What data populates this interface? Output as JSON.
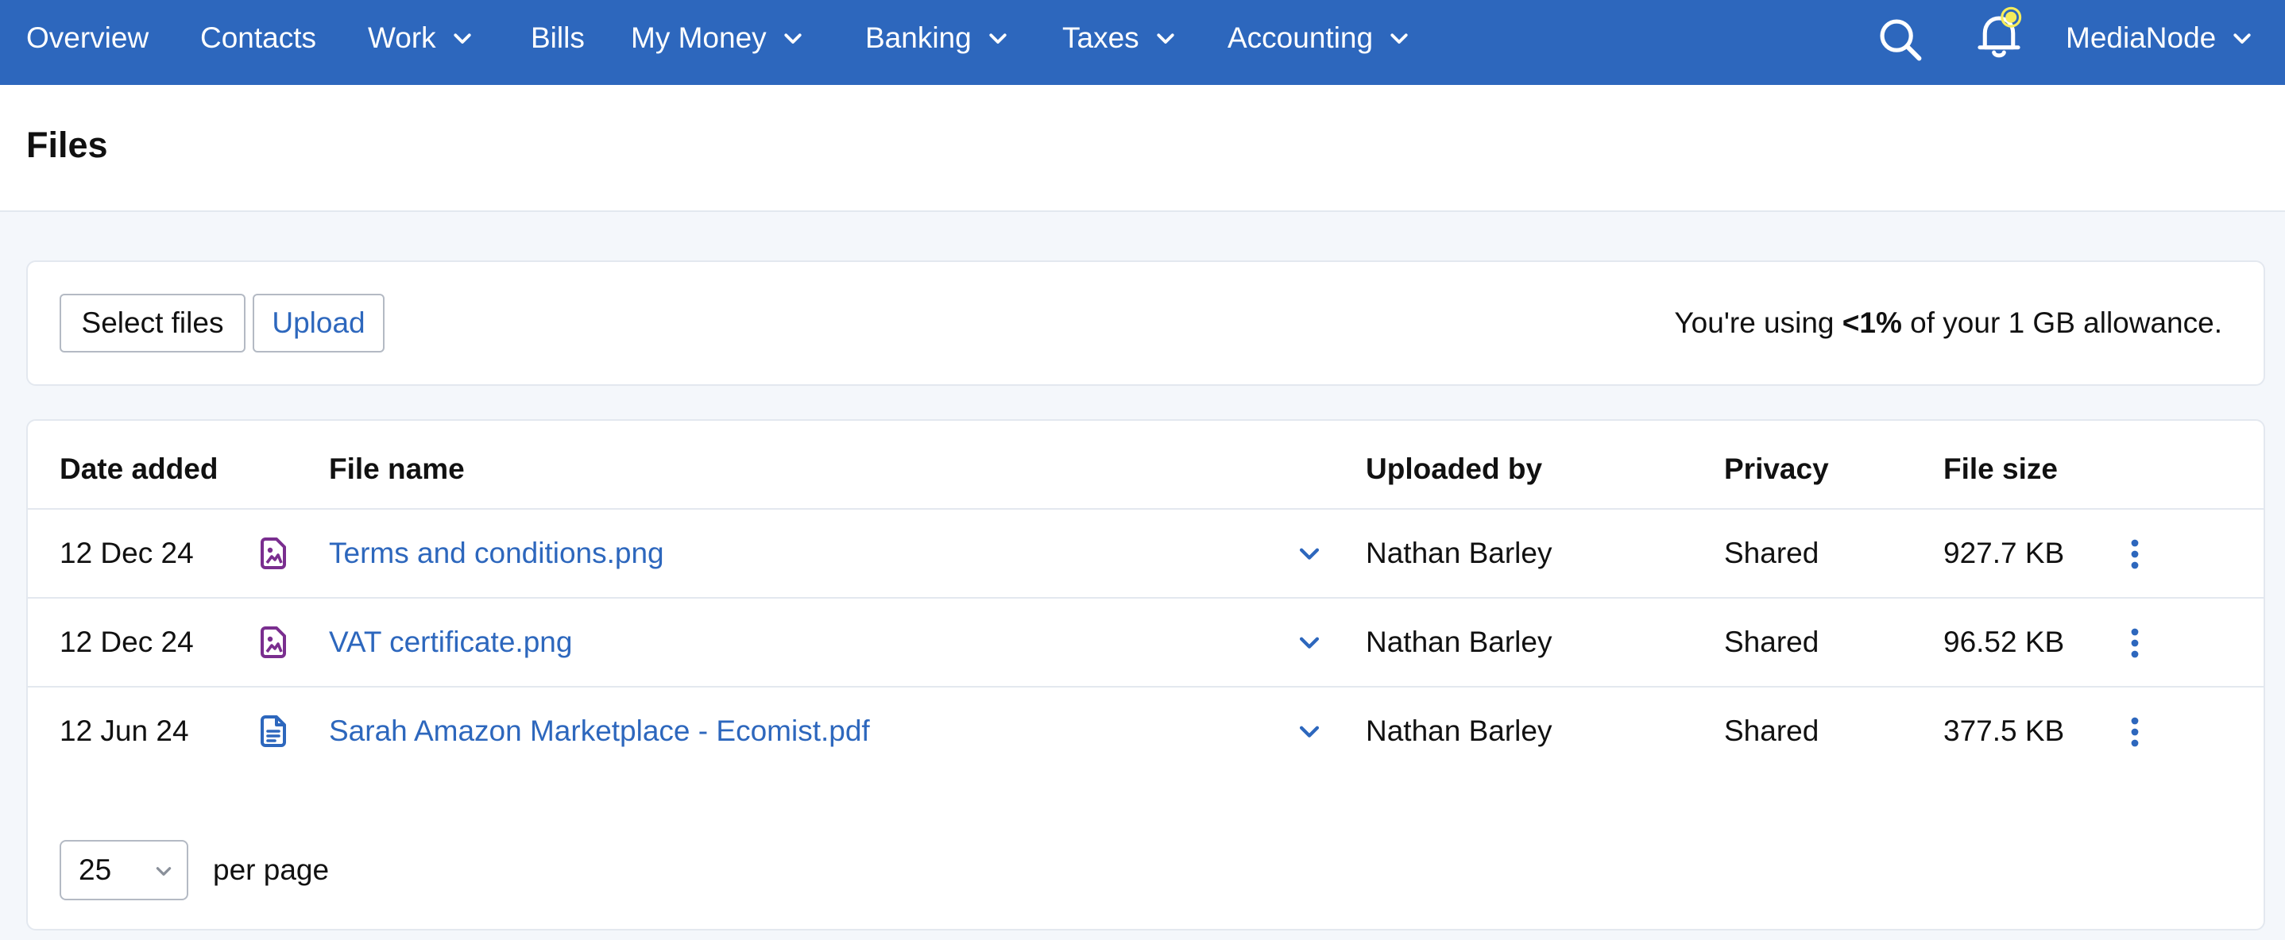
{
  "nav": {
    "items": [
      {
        "label": "Overview",
        "dropdown": false
      },
      {
        "label": "Contacts",
        "dropdown": false
      },
      {
        "label": "Work",
        "dropdown": true
      },
      {
        "label": "Bills",
        "dropdown": false
      },
      {
        "label": "My Money",
        "dropdown": true
      },
      {
        "label": "Banking",
        "dropdown": true
      },
      {
        "label": "Taxes",
        "dropdown": true
      },
      {
        "label": "Accounting",
        "dropdown": true
      }
    ],
    "account_label": "MediaNode",
    "icons": {
      "search": "search-icon",
      "notifications": "bell-icon",
      "notification_dot_color": "#f5ec5b"
    },
    "background_color": "#2d67bd"
  },
  "page": {
    "title": "Files"
  },
  "upload": {
    "select_files_label": "Select files",
    "upload_label": "Upload",
    "allowance_prefix": "You're using ",
    "allowance_amount": "<1%",
    "allowance_suffix": " of your 1 GB allowance."
  },
  "table": {
    "columns": {
      "date_added": "Date added",
      "file_name": "File name",
      "uploaded_by": "Uploaded by",
      "privacy": "Privacy",
      "file_size": "File size"
    },
    "rows": [
      {
        "date": "12 Dec 24",
        "icon": "image-file-icon",
        "name": "Terms and conditions.png",
        "uploaded_by": "Nathan Barley",
        "privacy": "Shared",
        "size": "927.7 KB"
      },
      {
        "date": "12 Dec 24",
        "icon": "image-file-icon",
        "name": "VAT certificate.png",
        "uploaded_by": "Nathan Barley",
        "privacy": "Shared",
        "size": "96.52 KB"
      },
      {
        "date": "12 Jun 24",
        "icon": "document-file-icon",
        "name": "Sarah Amazon Marketplace - Ecomist.pdf",
        "uploaded_by": "Nathan Barley",
        "privacy": "Shared",
        "size": "377.5 KB"
      }
    ]
  },
  "pagination": {
    "per_page_value": "25",
    "per_page_label": "per page"
  },
  "colors": {
    "accent": "#2d67bd",
    "image_icon": "#7a2e8f",
    "document_icon": "#2d67bd"
  }
}
